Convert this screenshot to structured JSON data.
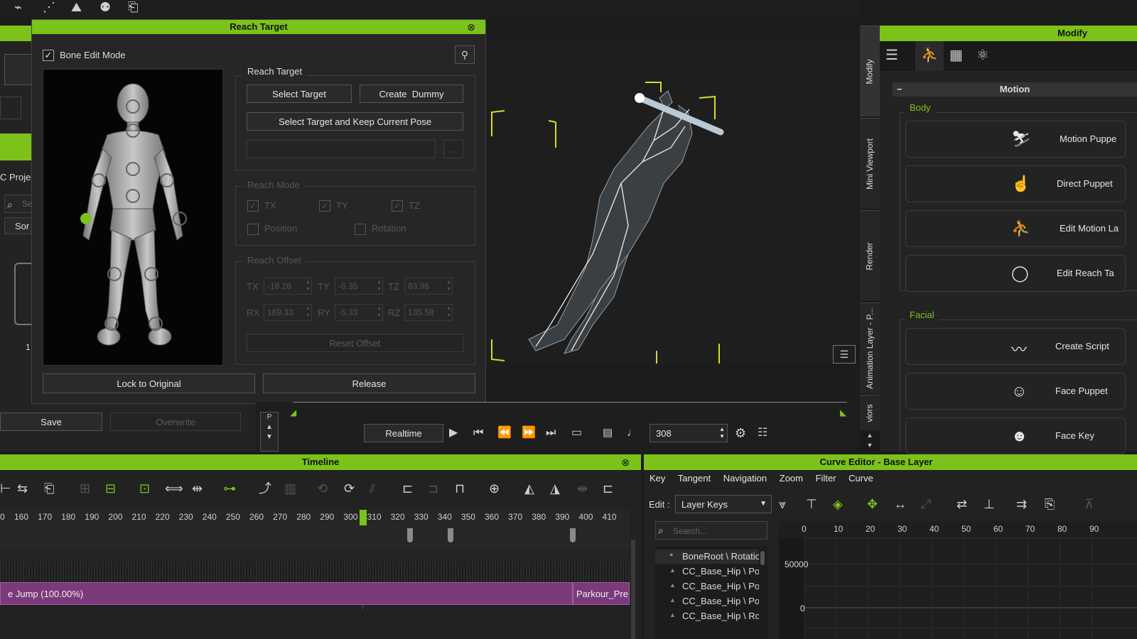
{
  "reach_target_dialog": {
    "title": "Reach Target",
    "bone_edit_mode_label": "Bone Edit Mode",
    "bone_edit_mode_checked": true,
    "group_reach_target": "Reach Target",
    "select_target": "Select Target",
    "create_dummy": "Create  Dummy",
    "select_keep_pose": "Select Target and Keep Current Pose",
    "more": "...",
    "group_reach_mode": "Reach Mode",
    "tx": "TX",
    "ty": "TY",
    "tz": "TZ",
    "position": "Position",
    "rotation": "Rotation",
    "group_reach_offset": "Reach Offset",
    "offset": {
      "tx_label": "TX",
      "tx": "-18.28",
      "ty_label": "TY",
      "ty": "-6.35",
      "tz_label": "TZ",
      "tz": "83.96",
      "rx_label": "RX",
      "rx": "169.33",
      "ry_label": "RY",
      "ry": "-5.33",
      "rz_label": "RZ",
      "rz": "135.58"
    },
    "reset_offset": "Reset Offset",
    "lock_to_original": "Lock to Original",
    "release": "Release"
  },
  "left_panel": {
    "project_label": "C Proje",
    "search_placeholder": "Se",
    "sort_label": "Sor",
    "save": "Save",
    "overwrite": "Overwrite",
    "count": "1"
  },
  "playback": {
    "realtime": "Realtime",
    "frame": "308"
  },
  "right_tabs": [
    "Modify",
    "Mini Viewport",
    "Render",
    "Animation Layer - P...",
    "viors"
  ],
  "modify_panel": {
    "title": "Modify",
    "section": "Motion",
    "body_label": "Body",
    "facial_label": "Facial",
    "body_buttons": [
      "Motion Puppe",
      "Direct Puppet",
      "Edit Motion La",
      "Edit Reach Ta"
    ],
    "facial_buttons": [
      "Create Script",
      "Face Puppet",
      "Face Key"
    ]
  },
  "timeline": {
    "title": "Timeline",
    "ticks": [
      "0",
      "160",
      "170",
      "180",
      "190",
      "200",
      "210",
      "220",
      "230",
      "240",
      "250",
      "260",
      "270",
      "280",
      "290",
      "300",
      "310",
      "320",
      "330",
      "340",
      "350",
      "360",
      "370",
      "380",
      "390",
      "400",
      "410"
    ],
    "clip_label": "e Jump (100.00%)",
    "clip2_label": "Parkour_Pre",
    "current_frame": 308
  },
  "curve_editor": {
    "title": "Curve Editor - Base Layer",
    "menu": [
      "Key",
      "Tangent",
      "Navigation",
      "Zoom",
      "Filter",
      "Curve"
    ],
    "edit_label": "Edit :",
    "edit_value": "Layer Keys",
    "search_placeholder": "Search...",
    "tree": [
      "BoneRoot \\ Rotatio",
      "CC_Base_Hip \\ Po",
      "CC_Base_Hip \\ Po",
      "CC_Base_Hip \\ Po",
      "CC_Base_Hip \\ Ro"
    ],
    "x_ticks": [
      "0",
      "10",
      "20",
      "30",
      "40",
      "50",
      "60",
      "70",
      "80",
      "90"
    ],
    "y_ticks": [
      "50000",
      "0"
    ]
  },
  "colors": {
    "accent": "#7cc21a",
    "bg": "#1c1c1c",
    "clip": "#7a3a7c",
    "gizmo": "#d8d82a"
  }
}
